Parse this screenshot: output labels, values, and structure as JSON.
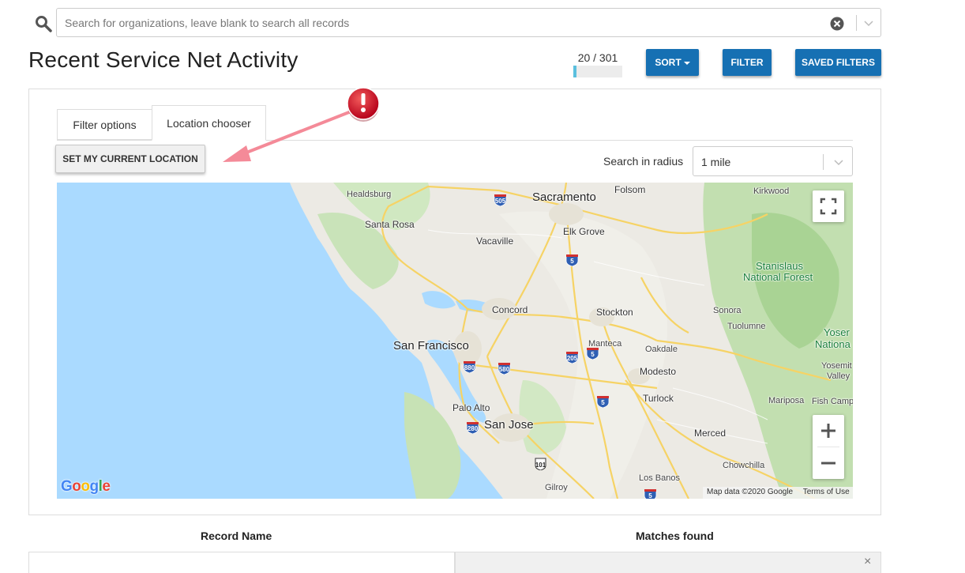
{
  "search": {
    "placeholder": "Search for organizations, leave blank to search all records",
    "value": ""
  },
  "header": {
    "title": "Recent Service Net Activity",
    "counter": "20 / 301",
    "progress_fraction": 0.066
  },
  "toolbar": {
    "sort_label": "SORT",
    "filter_label": "FILTER",
    "saved_filters_label": "SAVED FILTERS"
  },
  "tabs": [
    {
      "label": "Filter options",
      "active": false
    },
    {
      "label": "Location chooser",
      "active": true
    }
  ],
  "location": {
    "set_location_label": "SET MY CURRENT LOCATION",
    "radius_label": "Search in radius",
    "radius_value": "1 mile"
  },
  "map": {
    "cities": {
      "sacramento": "Sacramento",
      "folsom": "Folsom",
      "kirkwood": "Kirkwood",
      "healdsburg": "Healdsburg",
      "santa_rosa": "Santa Rosa",
      "elk_grove": "Elk Grove",
      "vacaville": "Vacaville",
      "stanislaus": "Stanislaus",
      "national_forest": "National Forest",
      "concord": "Concord",
      "stockton": "Stockton",
      "sonora": "Sonora",
      "tuolumne": "Tuolumne",
      "yosemite": "Yoser",
      "yosemite_np": "Nationa",
      "san_francisco": "San Francisco",
      "manteca": "Manteca",
      "oakdale": "Oakdale",
      "modesto": "Modesto",
      "yosemite_valley_1": "Yosemit",
      "yosemite_valley_2": "Valley",
      "turlock": "Turlock",
      "palo_alto": "Palo Alto",
      "san_jose": "San Jose",
      "mariposa": "Mariposa",
      "fish_camp": "Fish Camp",
      "merced": "Merced",
      "chowchilla": "Chowchilla",
      "los_banos": "Los Banos",
      "gilroy": "Gilroy"
    },
    "shields": {
      "i505": "505",
      "i5_north": "5",
      "i880": "880",
      "i580": "580",
      "i205": "205",
      "i5_mid": "5",
      "i5_manteca": "5",
      "i280": "280",
      "us101": "101",
      "i5_south": "5"
    },
    "logo": "Google",
    "attribution": "Map data ©2020 Google",
    "terms_label": "Terms of Use",
    "zoom_in": "+",
    "zoom_out": "−"
  },
  "table": {
    "headers": [
      "Record Name",
      "Matches found"
    ],
    "close_glyph": "×"
  },
  "colors": {
    "primary_button": "#1670b3",
    "progress_fill": "#5bc0de",
    "alert_red": "#c8102e",
    "arrow_pink": "#f48a98",
    "water": "#aadaff"
  }
}
